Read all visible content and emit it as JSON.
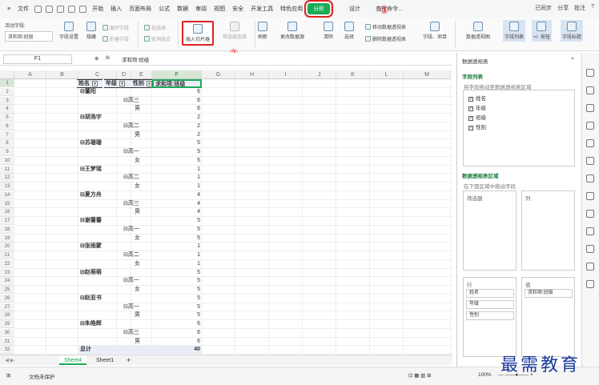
{
  "menu": {
    "file": "文件",
    "items": [
      "开始",
      "插入",
      "页面布局",
      "公式",
      "数据",
      "审阅",
      "视图",
      "安全",
      "开发工具",
      "特色应用"
    ],
    "active": "分析",
    "design": "设计",
    "search": "查找命令...",
    "right": [
      "已同步",
      "分享",
      "批注",
      "?"
    ]
  },
  "ribbon": {
    "active_field_label": "活动字段:",
    "active_field_value": "求和项:班级",
    "field_settings": "字段设置",
    "hide": "隐藏",
    "expand": "展开字段",
    "collapse": "折叠字段",
    "group_sel": "组选择",
    "ungroup": "取消组合",
    "insert_slicer": "插入切片器",
    "filter_conn": "筛选器连接",
    "refresh": "刷新",
    "change_source": "更改数据源",
    "clear": "清除",
    "select": "选择",
    "move_pivot": "移动数据透视表",
    "delete_pivot": "删除数据透视表",
    "fields_items": "字段、项目",
    "pivot_chart": "数据透视图",
    "field_list": "字段列表",
    "plus_minus": "+/- 按钮",
    "field_headers": "字段标题"
  },
  "annotations": {
    "a1": "①",
    "a2": "②"
  },
  "formula": {
    "name_box": "F1",
    "fx": "fx",
    "content": "求和项:班级"
  },
  "columns": [
    "A",
    "B",
    "C",
    "D",
    "E",
    "F",
    "G",
    "H",
    "I",
    "J",
    "K",
    "L",
    "M"
  ],
  "pivot": {
    "headers": [
      "姓名",
      "年级",
      "性别",
      "求和项:班级"
    ],
    "rows": [
      [
        "⊟董阳",
        "",
        "",
        "6"
      ],
      [
        "",
        "⊟高三",
        "",
        "6"
      ],
      [
        "",
        "",
        "男",
        "6"
      ],
      [
        "⊟胡浩宇",
        "",
        "",
        "2"
      ],
      [
        "",
        "⊟高二",
        "",
        "2"
      ],
      [
        "",
        "",
        "男",
        "2"
      ],
      [
        "⊟苏珊珊",
        "",
        "",
        "5"
      ],
      [
        "",
        "⊟高一",
        "",
        "5"
      ],
      [
        "",
        "",
        "女",
        "5"
      ],
      [
        "⊟王梦瑶",
        "",
        "",
        "1"
      ],
      [
        "",
        "⊟高二",
        "",
        "1"
      ],
      [
        "",
        "",
        "女",
        "1"
      ],
      [
        "⊟夏方舟",
        "",
        "",
        "4"
      ],
      [
        "",
        "⊟高三",
        "",
        "4"
      ],
      [
        "",
        "",
        "男",
        "4"
      ],
      [
        "⊟谢蕾蕾",
        "",
        "",
        "5"
      ],
      [
        "",
        "⊟高一",
        "",
        "5"
      ],
      [
        "",
        "",
        "女",
        "5"
      ],
      [
        "⊟张雨蒙",
        "",
        "",
        "1"
      ],
      [
        "",
        "⊟高二",
        "",
        "1"
      ],
      [
        "",
        "",
        "女",
        "1"
      ],
      [
        "⊟赵萌萌",
        "",
        "",
        "5"
      ],
      [
        "",
        "⊟高一",
        "",
        "5"
      ],
      [
        "",
        "",
        "女",
        "5"
      ],
      [
        "⊟赵亚书",
        "",
        "",
        "5"
      ],
      [
        "",
        "⊟高一",
        "",
        "5"
      ],
      [
        "",
        "",
        "男",
        "5"
      ],
      [
        "⊟朱皓辉",
        "",
        "",
        "6"
      ],
      [
        "",
        "⊟高三",
        "",
        "6"
      ],
      [
        "",
        "",
        "男",
        "6"
      ],
      [
        "总计",
        "",
        "",
        "40"
      ]
    ]
  },
  "sheets": [
    "Sheet4",
    "Sheet1"
  ],
  "status": {
    "protect": "文档未保护",
    "zoom": "100%"
  },
  "panel": {
    "title": "数据透视表",
    "field_list": "字段列表",
    "field_hint": "将字段拖动至数据透视表区域",
    "fields": [
      "姓名",
      "年级",
      "班级",
      "性别"
    ],
    "areas_title": "数据透视表区域",
    "areas_hint": "在下面区域中拖动字段",
    "filter": "筛选器",
    "columns": "列",
    "rows": "行",
    "values": "值",
    "row_fields": [
      "姓名",
      "年级",
      "性别"
    ],
    "value_fields": [
      "求和项:班级"
    ]
  },
  "watermark": "最需教育"
}
